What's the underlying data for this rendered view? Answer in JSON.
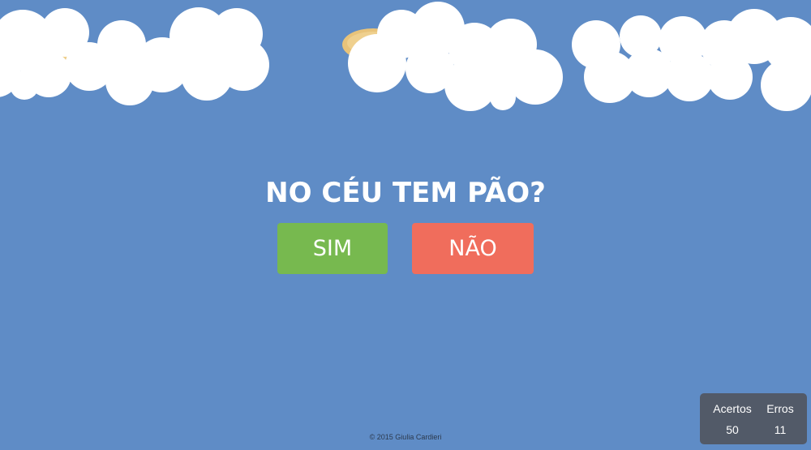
{
  "game": {
    "question": "NO CÉU TEM PÃO?",
    "yes_label": "SIM",
    "no_label": "NÃO"
  },
  "score": {
    "hits_label": "Acertos",
    "hits_value": "50",
    "errors_label": "Erros",
    "errors_value": "11"
  },
  "footer": {
    "copyright": "© 2015 Giulia Cardieri"
  },
  "colors": {
    "sky": "#5f8cc6",
    "cloud": "#ffffff",
    "bread": "#e8c37a",
    "yes_button": "#77b94f",
    "no_button": "#f06d5c",
    "score_panel": "#525a68"
  },
  "icons": {
    "bread": "bread-loaf-icon",
    "cloud": "cloud-shape"
  }
}
